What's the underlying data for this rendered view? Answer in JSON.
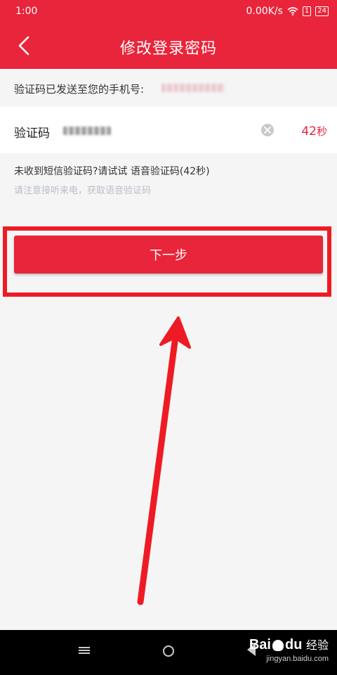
{
  "status_bar": {
    "time": "1:00",
    "network_speed": "0.00K/s",
    "sim_badge": "1",
    "battery": "24"
  },
  "header": {
    "title": "修改登录密码"
  },
  "sent_notice": {
    "label": "验证码已发送至您的手机号:"
  },
  "code_field": {
    "label": "验证码",
    "countdown_value": "42",
    "countdown_unit": "秒"
  },
  "voice_prompt": {
    "prefix": "未收到短信验证码?请试试",
    "link": "语音验证码(42秒)"
  },
  "voice_note": "请注意接听来电，获取语音验证码",
  "next_button": {
    "label": "下一步"
  },
  "watermark": {
    "brand_bai": "Bai",
    "brand_du": "du",
    "brand_jingyan": "经验",
    "url": "jingyan.baidu.com"
  },
  "colors": {
    "brand_red": "#e8253a",
    "highlight_red": "#ee1b24",
    "hint_gray": "#b9bfc7"
  },
  "icons": {
    "back": "chevron-left-icon",
    "clear": "clear-circle-icon",
    "wifi": "wifi-icon"
  }
}
